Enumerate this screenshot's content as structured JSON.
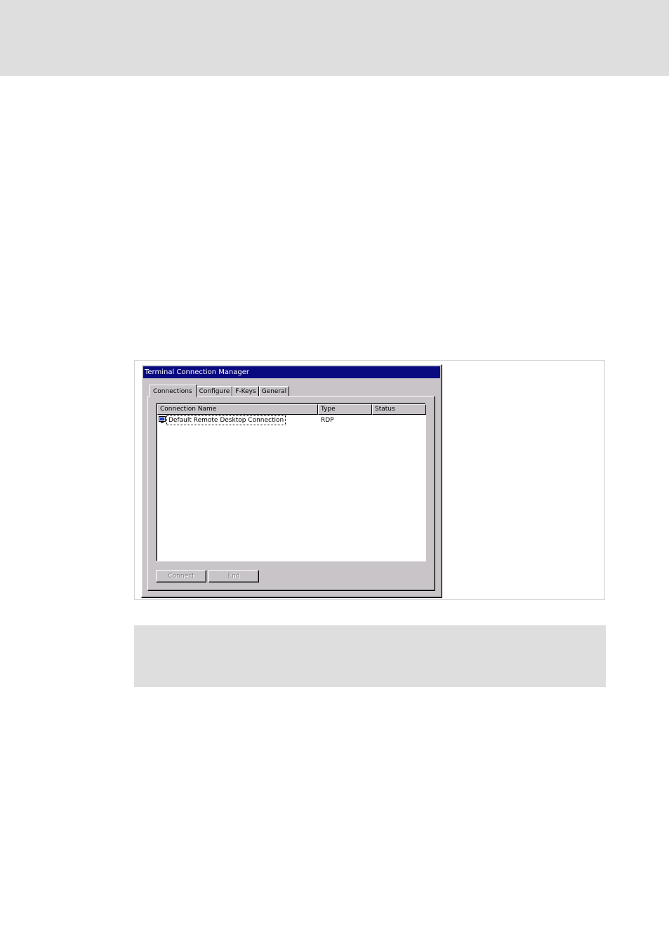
{
  "window": {
    "title": "Terminal Connection Manager"
  },
  "tabs": [
    {
      "label": "Connections",
      "active": true
    },
    {
      "label": "Configure",
      "active": false
    },
    {
      "label": "F-Keys",
      "active": false
    },
    {
      "label": "General",
      "active": false
    }
  ],
  "list": {
    "columns": [
      "Connection Name",
      "Type",
      "Status"
    ],
    "rows": [
      {
        "icon": "remote-desktop-icon",
        "name": "Default Remote Desktop Connection",
        "type": "RDP",
        "status": ""
      }
    ]
  },
  "buttons": {
    "connect_label": "Connect",
    "end_label": "End"
  },
  "colors": {
    "titlebar": "#0a0a80",
    "window_face": "#c8c4c8",
    "page_band": "#dedede"
  }
}
